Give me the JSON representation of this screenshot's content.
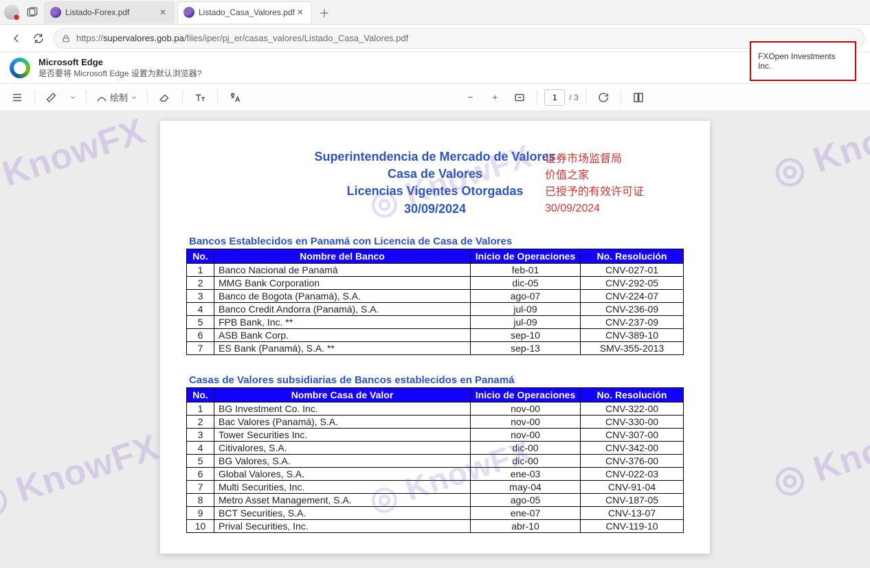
{
  "tabs": [
    {
      "title": "Listado-Forex.pdf"
    },
    {
      "title": "Listado_Casa_Valores.pdf"
    }
  ],
  "url_host": "supervalores.gob.pa",
  "url_path": "/files/iper/pj_er/casas_valores/Listado_Casa_Valores.pdf",
  "url_full": "https://supervalores.gob.pa/files/iper/pj_er/casas_valores/Listado_Casa_Valores.pdf",
  "default_bar": {
    "title": "Microsoft Edge",
    "subtitle": "是否要将 Microsoft Edge 设置为默认浏览器?"
  },
  "toolbar": {
    "draw_label": "绘制",
    "page_current": "1",
    "page_total": "/ 3"
  },
  "callout": "FXOpen Investments Inc.",
  "watermark": "KnowFX",
  "doc": {
    "title_l1": "Superintendencia de Mercado de Valores",
    "title_l2": "Casa de Valores",
    "title_l3": "Licencias  Vigentes Otorgadas",
    "title_l4": "30/09/2024"
  },
  "annot": {
    "l1": "证券市场监督局",
    "l2": "价值之家",
    "l3": "已授予的有效许可证",
    "l4": "30/09/2024"
  },
  "sec1": {
    "heading": "Bancos Establecidos en Panamá con Licencia de Casa de Valores",
    "h_no": "No.",
    "h_name": "Nombre del Banco",
    "h_date": "Inicio de Operaciones",
    "h_res": "No. Resolución",
    "rows": [
      {
        "n": "1",
        "name": "Banco Nacional de Panamá",
        "date": "feb-01",
        "res": "CNV-027-01"
      },
      {
        "n": "2",
        "name": "MMG Bank Corporation",
        "date": "dic-05",
        "res": "CNV-292-05"
      },
      {
        "n": "3",
        "name": "Banco de Bogota (Panamá), S.A.",
        "date": "ago-07",
        "res": "CNV-224-07"
      },
      {
        "n": "4",
        "name": "Banco Credit Andorra (Panamá), S.A.",
        "date": "jul-09",
        "res": "CNV-236-09"
      },
      {
        "n": "5",
        "name": "FPB Bank, Inc. **",
        "date": "jul-09",
        "res": "CNV-237-09"
      },
      {
        "n": "6",
        "name": "ASB Bank Corp.",
        "date": "sep-10",
        "res": "CNV-389-10"
      },
      {
        "n": "7",
        "name": "ES Bank (Panamá), S.A. **",
        "date": "sep-13",
        "res": "SMV-355-2013"
      }
    ]
  },
  "sec2": {
    "heading": "Casas de Valores  subsidiarias  de Bancos establecidos en Panamá",
    "h_no": "No.",
    "h_name": "Nombre Casa de Valor",
    "h_date": "Inicio de Operaciones",
    "h_res": "No. Resolución",
    "rows": [
      {
        "n": "1",
        "name": "BG Investment Co. Inc.",
        "date": "nov-00",
        "res": "CNV-322-00"
      },
      {
        "n": "2",
        "name": "Bac Valores (Panamá), S.A.",
        "date": "nov-00",
        "res": "CNV-330-00"
      },
      {
        "n": "3",
        "name": "Tower Securities Inc.",
        "date": "nov-00",
        "res": "CNV-307-00"
      },
      {
        "n": "4",
        "name": "Citivalores, S.A.",
        "date": "dic-00",
        "res": "CNV-342-00"
      },
      {
        "n": "5",
        "name": "BG Valores, S.A.",
        "date": "dic-00",
        "res": "CNV-376-00"
      },
      {
        "n": "6",
        "name": "Global Valores, S.A.",
        "date": "ene-03",
        "res": "CNV-022-03"
      },
      {
        "n": "7",
        "name": "Multi Securities, Inc.",
        "date": "may-04",
        "res": "CNV-91-04"
      },
      {
        "n": "8",
        "name": "Metro Asset Management, S.A.",
        "date": "ago-05",
        "res": "CNV-187-05"
      },
      {
        "n": "9",
        "name": "BCT Securities, S.A.",
        "date": "ene-07",
        "res": "CNV-13-07"
      },
      {
        "n": "10",
        "name": "Prival Securities, Inc.",
        "date": "abr-10",
        "res": "CNV-119-10"
      }
    ]
  }
}
